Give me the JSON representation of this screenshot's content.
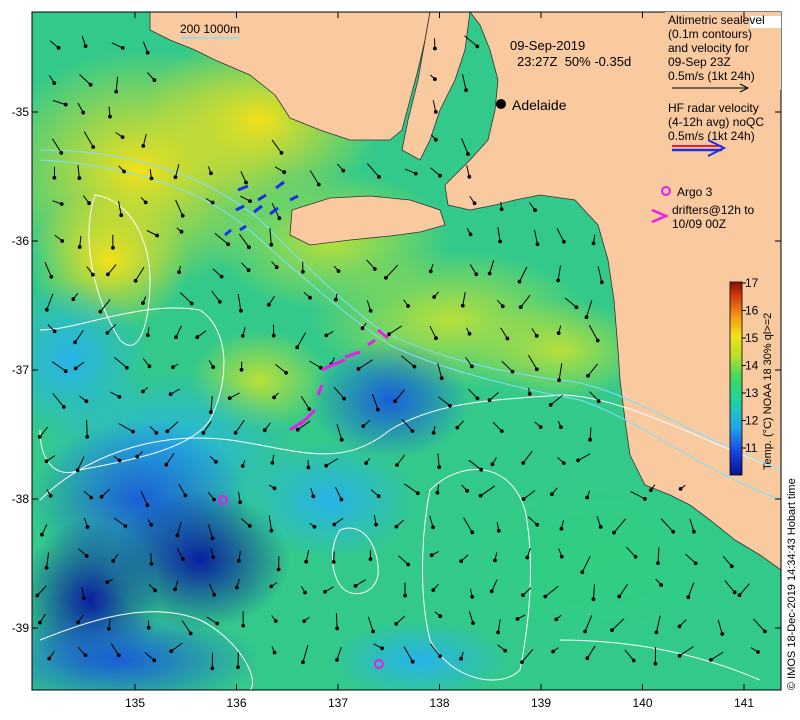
{
  "map": {
    "date": "09-Sep-2019",
    "time_info": "23:27Z  50% -0.35d",
    "place": "Adelaide",
    "scale_label": "200  1000m",
    "legend_altimetric": [
      "Altimetric sealevel",
      "(0.1m contours)",
      "and velocity for",
      "09-Sep 23Z",
      "0.5m/s (1kt 24h)"
    ],
    "legend_hf": [
      "HF radar velocity",
      "(4-12h avg) noQC",
      "0.5m/s (1kt 24h)"
    ],
    "legend_argo": "Argo 3",
    "legend_drifters": [
      "drifters@12h to",
      "10/09 00Z"
    ],
    "colorbar_title": "Temp. (°C) NOAA 18 30% ql>=2",
    "colorbar_ticks": [
      "11",
      "12",
      "13",
      "14",
      "15",
      "16",
      "17"
    ],
    "credit": "© IMOS 18-Dec-2019 14:34:43 Hobart time",
    "lon_ticks": [
      "135",
      "136",
      "137",
      "138",
      "139",
      "140",
      "141"
    ],
    "lat_ticks": [
      "-35",
      "-36",
      "-37",
      "-38",
      "-39"
    ],
    "colors": {
      "land": "#f9c9a0",
      "drifter": "#e81ee8",
      "hf_red": "#e8202a",
      "hf_blue": "#1e2ee8",
      "contour": "#ffffff"
    }
  }
}
